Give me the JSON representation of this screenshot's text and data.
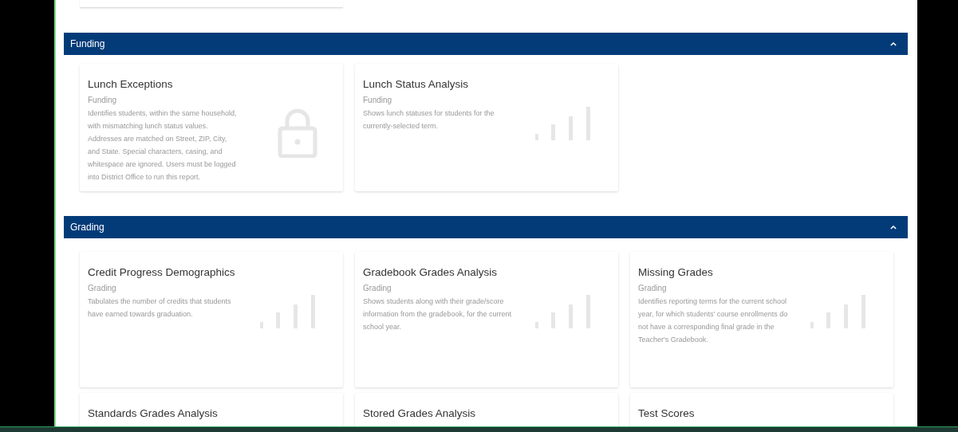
{
  "sections": [
    {
      "title": "Funding",
      "expanded": true,
      "cards": [
        {
          "title": "Lunch Exceptions",
          "category": "Funding",
          "description": "Identifies students, within the same household, with mismatching lunch status values. Addresses are matched on Street, ZIP, City, and State. Special characters, casing, and whitespace are ignored. Users must be logged into District Office to run this report.",
          "kind": "locked"
        },
        {
          "title": "Lunch Status Analysis",
          "category": "Funding",
          "description": "Shows lunch statuses for students for the currently-selected term.",
          "kind": "report"
        }
      ]
    },
    {
      "title": "Grading",
      "expanded": true,
      "cards": [
        {
          "title": "Credit Progress Demographics",
          "category": "Grading",
          "description": "Tabulates the number of credits that students have earned towards graduation.",
          "kind": "report"
        },
        {
          "title": "Gradebook Grades Analysis",
          "category": "Grading",
          "description": "Shows students along with their grade/score information from the gradebook, for the current school year.",
          "kind": "report"
        },
        {
          "title": "Missing Grades",
          "category": "Grading",
          "description": "Identifies reporting terms for the current school year, for which students' course enrollments do not have a corresponding final grade in the Teacher's Gradebook.",
          "kind": "report"
        },
        {
          "title": "Standards Grades Analysis"
        },
        {
          "title": "Stored Grades Analysis"
        },
        {
          "title": "Test Scores"
        }
      ]
    }
  ]
}
